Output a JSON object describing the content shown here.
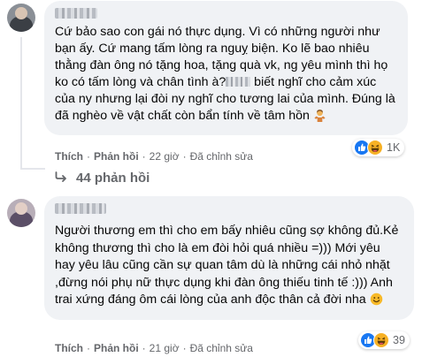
{
  "comments": [
    {
      "paragraph_before": "Cứ bảo sao con gái nó thực dụng. Vì có những người như bạn ấy. Cứ mang tấm lòng ra nguỵ biện. Ko lẽ bao nhiêu thằng đàn ông nó tặng hoa, tặng quà vk, ng yêu mình thì họ ko có tấm lòng và chân tình à?",
      "paragraph_after": " biết nghĩ cho cảm xúc của ny nhưng lại đòi ny nghĩ cho tương lai của mình. Đúng là đã nghèo về vật chất còn bẩn tính về tâm hồn ",
      "end_emoji": "person-shrugging-emoji",
      "reaction_count": "1K",
      "reactions": [
        "like",
        "haha"
      ],
      "actions": {
        "like": "Thích",
        "reply": "Phản hồi",
        "time": "22 giờ",
        "edited": "Đã chỉnh sửa"
      }
    },
    {
      "text": "Người thương em thì cho em bấy nhiêu cũng sợ không đủ.Kẻ không thương thì cho là em đòi hỏi quá nhiều =))) Mới yêu hay yêu lâu cũng cần sự quan tâm dù là những cái nhỏ nhặt ,đừng nói phụ nữ thực dụng khi đàn ông thiếu tinh tế :))) Anh trai xứng đáng ôm cái lòng của anh độc thân cả đời nha ",
      "end_emoji": "smiling-face-emoji",
      "reaction_count": "39",
      "reactions": [
        "like",
        "haha"
      ],
      "actions": {
        "like": "Thích",
        "reply": "Phản hồi",
        "time": "21 giờ",
        "edited": "Đã chỉnh sửa"
      }
    }
  ],
  "replies_label": "44 phản hồi",
  "colors": {
    "bubble": "#f0f2f5",
    "secondary_text": "#65676b",
    "like_blue": "#1877f2",
    "haha_yellow": "#f7b125"
  }
}
